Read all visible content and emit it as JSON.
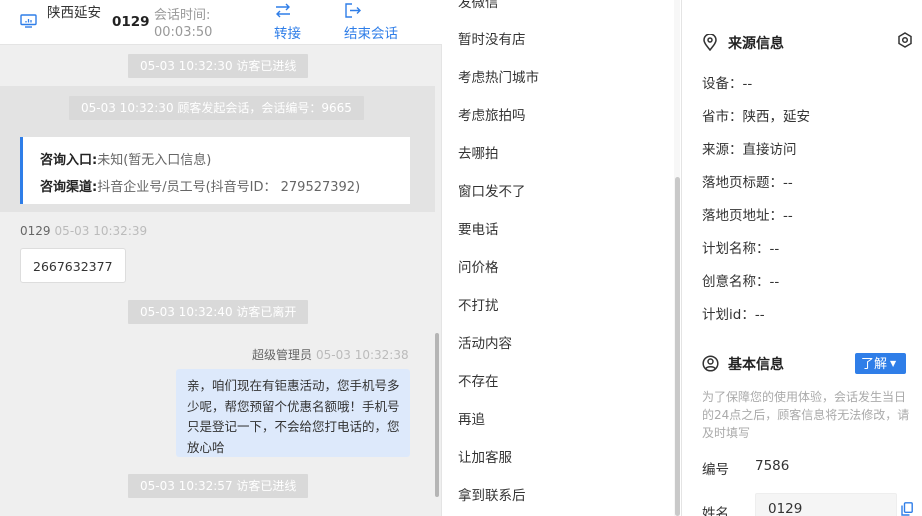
{
  "header": {
    "location": "陕西延安",
    "visitor_id": "0129",
    "session_time_label": "会话时间:",
    "session_time_value": "00:03:50",
    "transfer_label": "转接",
    "end_label": "结束会话"
  },
  "chat": {
    "sys_1": "05-03 10:32:30 访客已进线",
    "sys_2": "05-03 10:32:30 顾客发起会话，会话编号：9665",
    "entry_label": "咨询入口:",
    "entry_value": "未知(暂无入口信息)",
    "channel_label": "咨询渠道:",
    "channel_value": "抖音企业号/员工号(抖音号ID： 279527392)",
    "visitor_name": "0129",
    "visitor_time": "05-03 10:32:39",
    "visitor_message": "2667632377",
    "sys_3": "05-03 10:32:40 访客已离开",
    "agent_name": "超级管理员",
    "agent_time": "05-03 10:32:38",
    "agent_message": "亲，咱们现在有钜惠活动，您手机号多少呢，帮您预留个优惠名额哦！手机号只是登记一下，不会给您打电话的，您放心哈",
    "sys_4": "05-03 10:32:57 访客已进线"
  },
  "quick_replies": {
    "items": [
      "发微信",
      "暂时没有店",
      "考虑热门城市",
      "考虑旅拍吗",
      "去哪拍",
      "窗口发不了",
      "要电话",
      "问价格",
      "不打扰",
      "活动内容",
      "不存在",
      "再追",
      "让加客服",
      "拿到联系后"
    ]
  },
  "source_info": {
    "title": "来源信息",
    "device": "设备：--",
    "province_city": "省市：陕西，延安",
    "source": "来源：直接访问",
    "landing_title": "落地页标题：--",
    "landing_url": "落地页地址：--",
    "plan_name": "计划名称：--",
    "creative_name": "创意名称：--",
    "plan_id": "计划id：--"
  },
  "basic_info": {
    "title": "基本信息",
    "learn_more": "了解",
    "notice": "为了保障您的使用体验，会话发生当日的24点之后，顾客信息将无法修改，请及时填写",
    "id_label": "编号",
    "id_value": "7586",
    "name_label": "姓名",
    "name_value": "0129"
  },
  "colors": {
    "accent": "#2f7ee8",
    "agent_bubble": "#dde9fb",
    "system_pill": "#d9d9d9"
  },
  "icons": {
    "header": "monitor-icon",
    "transfer": "transfer-arrows-icon",
    "end": "exit-icon",
    "source": "location-pin-icon",
    "settings": "gear-icon",
    "basic": "user-circle-icon",
    "copy": "copy-icon"
  }
}
